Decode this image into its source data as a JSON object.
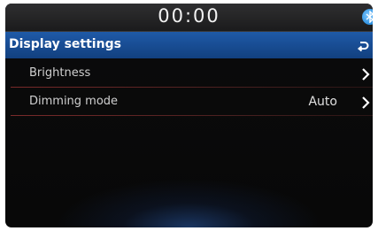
{
  "status_bar": {
    "clock": "00:00",
    "bluetooth_icon": "bluetooth-icon"
  },
  "header": {
    "title": "Display settings",
    "back_icon": "back-arrow-icon"
  },
  "menu": {
    "items": [
      {
        "label": "Brightness",
        "value": "",
        "icon": "chevron-right-icon"
      },
      {
        "label": "Dimming mode",
        "value": "Auto",
        "icon": "chevron-right-icon"
      }
    ]
  },
  "colors": {
    "header_bg": "#1a4f96",
    "background": "#0a0a0a",
    "divider": "#6a2525",
    "accent_glow": "#2a5aa8"
  }
}
